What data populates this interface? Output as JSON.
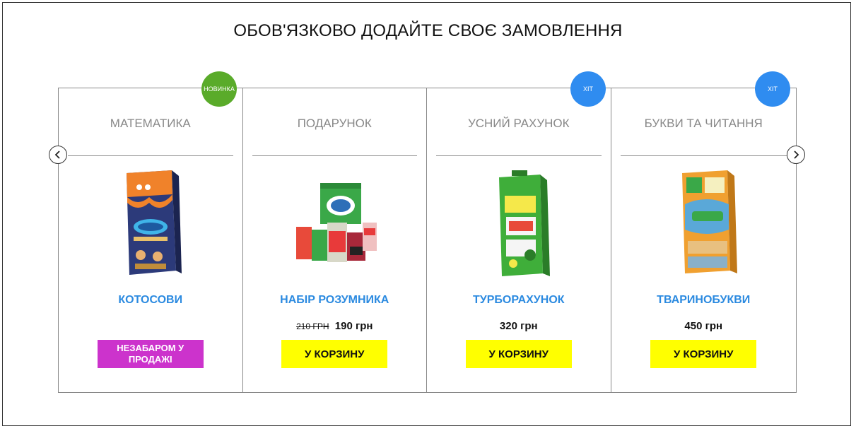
{
  "heading": "ОБОВ'ЯЗКОВО ДОДАЙТЕ СВОЄ ЗАМОВЛЕННЯ",
  "carousel": {
    "prev_icon": "chevron-left-icon",
    "next_icon": "chevron-right-icon",
    "cards": [
      {
        "category": "МАТЕМАТИКА",
        "badge": "НОВИНКА",
        "name": "КОТОСОВИ",
        "button": "НЕЗАБАРОМ У ПРОДАЖІ"
      },
      {
        "category": "ПОДАРУНОК",
        "name": "НАБІР РОЗУМНИКА",
        "old_price": "210 ГРН",
        "price": "190 грн",
        "button": "У КОРЗИНУ"
      },
      {
        "category": "УСНИЙ РАХУНОК",
        "badge": "ХІТ",
        "name": "ТУРБОРАХУНОК",
        "price": "320 грн",
        "button": "У КОРЗИНУ"
      },
      {
        "category": "БУКВИ ТА ЧИТАННЯ",
        "badge": "ХІТ",
        "name": "ТВАРИНОБУКВИ",
        "price": "450 грн",
        "button": "У КОРЗИНУ"
      }
    ]
  },
  "colors": {
    "accent_blue": "#2b8ae0",
    "cart_button": "#ffff00",
    "soon_button": "#cc33cc",
    "badge_new": "#5aab2a",
    "badge_hit": "#2f8cf0"
  }
}
